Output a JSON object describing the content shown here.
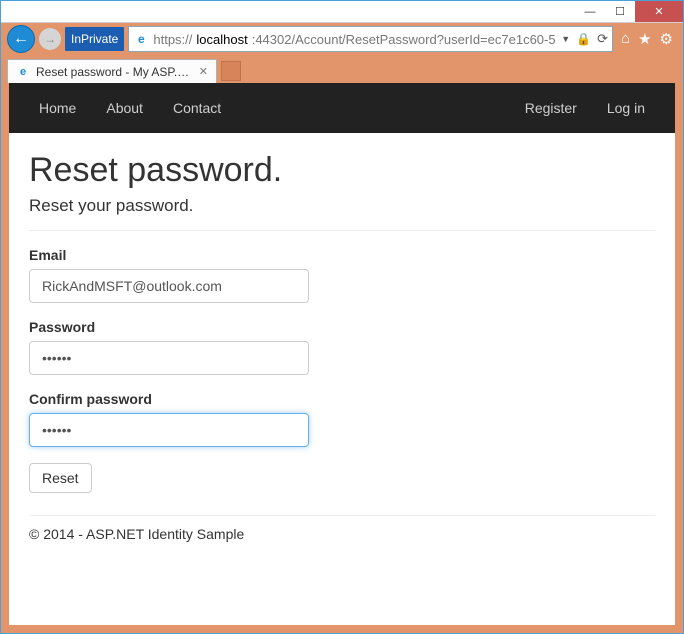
{
  "window": {
    "minimize": "—",
    "maximize": "☐",
    "close": "✕"
  },
  "addressbar": {
    "inprivate_label": "InPrivate",
    "protocol": "https://",
    "host": "localhost",
    "rest": ":44302/Account/ResetPassword?userId=ec7e1c60-5"
  },
  "tab": {
    "title": "Reset password - My ASP.N..."
  },
  "navbar": {
    "home": "Home",
    "about": "About",
    "contact": "Contact",
    "register": "Register",
    "login": "Log in"
  },
  "page": {
    "heading": "Reset password.",
    "subtitle": "Reset your password.",
    "email_label": "Email",
    "email_value": "RickAndMSFT@outlook.com",
    "password_label": "Password",
    "password_value": "••••••",
    "confirm_label": "Confirm password",
    "confirm_value": "••••••",
    "reset_button": "Reset",
    "footer": "© 2014 - ASP.NET Identity Sample"
  }
}
